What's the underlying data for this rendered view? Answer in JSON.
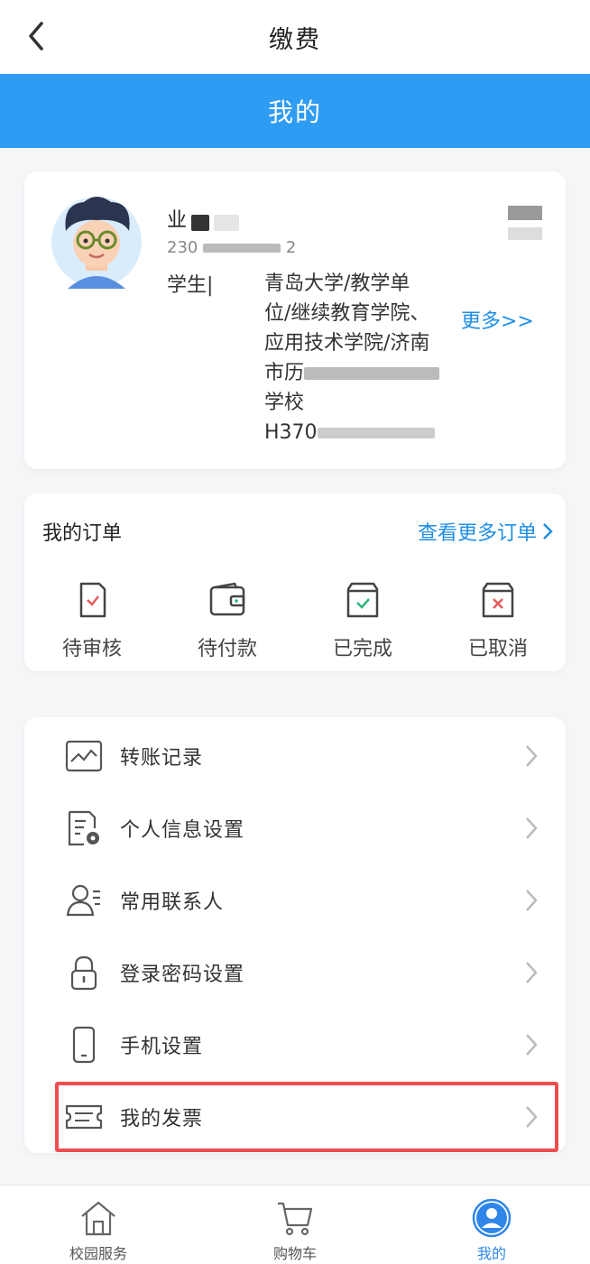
{
  "navbar": {
    "title": "缴费"
  },
  "header": {
    "title": "我的"
  },
  "profile": {
    "name_visible": "业",
    "id_visible": "230",
    "id_suffix": "2",
    "role": "学生|",
    "organization_lines": [
      "青岛大学/教学单",
      "位/继续教育学院、",
      "应用技术学院/济南",
      "市历",
      "学校",
      "H370"
    ],
    "more_link": "更多>>"
  },
  "orders": {
    "title": "我的订单",
    "more_label": "查看更多订单",
    "items": [
      {
        "label": "待审核",
        "icon": "pending-review-icon"
      },
      {
        "label": "待付款",
        "icon": "wallet-icon"
      },
      {
        "label": "已完成",
        "icon": "completed-box-icon"
      },
      {
        "label": "已取消",
        "icon": "cancelled-box-icon"
      }
    ]
  },
  "menu": {
    "items": [
      {
        "label": "转账记录",
        "icon": "trend-chart-icon"
      },
      {
        "label": "个人信息设置",
        "icon": "document-gear-icon"
      },
      {
        "label": "常用联系人",
        "icon": "contact-icon"
      },
      {
        "label": "登录密码设置",
        "icon": "lock-icon"
      },
      {
        "label": "手机设置",
        "icon": "phone-icon"
      },
      {
        "label": "我的发票",
        "icon": "ticket-icon"
      }
    ]
  },
  "tabbar": {
    "items": [
      {
        "label": "校园服务",
        "icon": "home-icon"
      },
      {
        "label": "购物车",
        "icon": "cart-icon"
      },
      {
        "label": "我的",
        "icon": "user-icon",
        "active": true
      }
    ]
  },
  "colors": {
    "accent": "#2f9cf4",
    "link": "#1f8fe6",
    "highlight": "#ee4d4f"
  }
}
